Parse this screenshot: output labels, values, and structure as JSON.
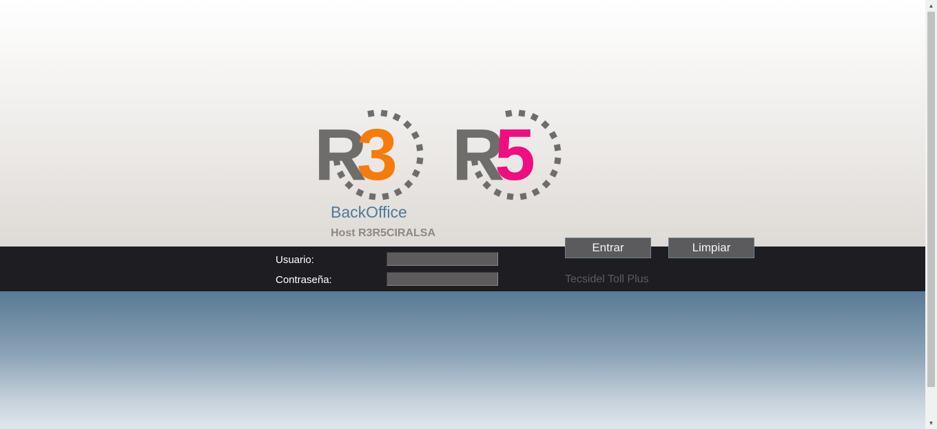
{
  "logos": {
    "r3": {
      "letter": "R",
      "digit": "3",
      "digit_color": "#f57c0a"
    },
    "r5": {
      "letter": "R",
      "digit": "5",
      "digit_color": "#ef0d7f"
    },
    "letter_color": "#6f6d6c",
    "dash_color": "#6f6d6c"
  },
  "app": {
    "title": "BackOffice",
    "host": "Host R3R5CIRALSA",
    "product": "Tecsidel Toll Plus"
  },
  "form": {
    "username_label": "Usuario:",
    "username_value": "",
    "password_label": "Contraseña:",
    "password_value": ""
  },
  "buttons": {
    "submit_label": "Entrar",
    "clear_label": "Limpiar"
  },
  "scrollbar": {
    "up_icon": "▲",
    "down_icon": "▼"
  },
  "colors": {
    "band": "#1e1d22",
    "title_blue": "#4f7898",
    "host_grey": "#8f8782"
  }
}
